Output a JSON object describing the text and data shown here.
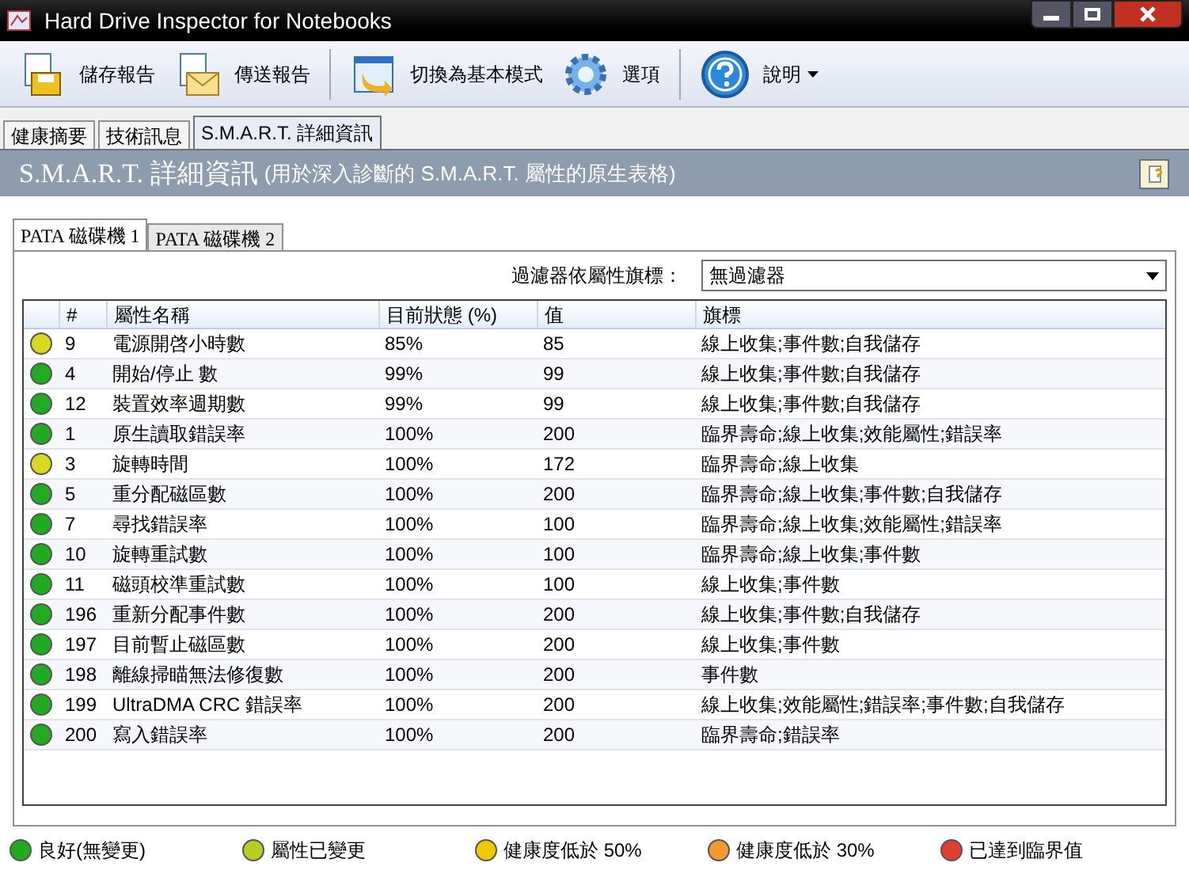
{
  "window": {
    "title": "Hard Drive Inspector for Notebooks"
  },
  "toolbar": [
    {
      "label": "儲存報告",
      "kind": "save"
    },
    {
      "label": "傳送報告",
      "kind": "send"
    },
    {
      "label": "切換為基本模式",
      "kind": "switch"
    },
    {
      "label": "選項",
      "kind": "options"
    },
    {
      "label": "說明",
      "kind": "help"
    }
  ],
  "tabs": [
    {
      "label": "健康摘要",
      "selected": false
    },
    {
      "label": "技術訊息",
      "selected": false
    },
    {
      "label": "S.M.A.R.T. 詳細資訊",
      "selected": true
    }
  ],
  "header": {
    "title": "S.M.A.R.T. 詳細資訊",
    "subtitle": "(用於深入診斷的 S.M.A.R.T. 屬性的原生表格)"
  },
  "drive_tabs": [
    {
      "label": "PATA 磁碟機 1",
      "selected": true
    },
    {
      "label": "PATA 磁碟機 2",
      "selected": false
    }
  ],
  "filter": {
    "label": "過濾器依屬性旗標：",
    "value": "無過濾器"
  },
  "table": {
    "columns": [
      "#",
      "屬性名稱",
      "目前狀態 (%)",
      "值",
      "旗標"
    ],
    "rows": [
      {
        "color": "#d8d820",
        "cells": [
          "9",
          "電源開啓小時數",
          "85%",
          "85",
          "線上收集;事件數;自我儲存"
        ]
      },
      {
        "color": "#22aa22",
        "cells": [
          "4",
          "開始/停止 數",
          "99%",
          "99",
          "線上收集;事件數;自我儲存"
        ]
      },
      {
        "color": "#22aa22",
        "cells": [
          "12",
          "裝置效率週期數",
          "99%",
          "99",
          "線上收集;事件數;自我儲存"
        ]
      },
      {
        "color": "#22aa22",
        "cells": [
          "1",
          "原生讀取錯誤率",
          "100%",
          "200",
          "臨界壽命;線上收集;效能屬性;錯誤率"
        ]
      },
      {
        "color": "#d8d820",
        "cells": [
          "3",
          "旋轉時間",
          "100%",
          "172",
          "臨界壽命;線上收集"
        ]
      },
      {
        "color": "#22aa22",
        "cells": [
          "5",
          "重分配磁區數",
          "100%",
          "200",
          "臨界壽命;線上收集;事件數;自我儲存"
        ]
      },
      {
        "color": "#22aa22",
        "cells": [
          "7",
          "尋找錯誤率",
          "100%",
          "100",
          "臨界壽命;線上收集;效能屬性;錯誤率"
        ]
      },
      {
        "color": "#22aa22",
        "cells": [
          "10",
          "旋轉重試數",
          "100%",
          "100",
          "臨界壽命;線上收集;事件數"
        ]
      },
      {
        "color": "#22aa22",
        "cells": [
          "11",
          "磁頭校準重試數",
          "100%",
          "100",
          "線上收集;事件數"
        ]
      },
      {
        "color": "#22aa22",
        "cells": [
          "196",
          "重新分配事件數",
          "100%",
          "200",
          "線上收集;事件數;自我儲存"
        ]
      },
      {
        "color": "#22aa22",
        "cells": [
          "197",
          "目前暫止磁區數",
          "100%",
          "200",
          "線上收集;事件數"
        ]
      },
      {
        "color": "#22aa22",
        "cells": [
          "198",
          "離線掃瞄無法修復數",
          "100%",
          "200",
          "事件數"
        ]
      },
      {
        "color": "#22aa22",
        "cells": [
          "199",
          "UltraDMA CRC 錯誤率",
          "100%",
          "200",
          "線上收集;效能屬性;錯誤率;事件數;自我儲存"
        ]
      },
      {
        "color": "#22aa22",
        "cells": [
          "200",
          "寫入錯誤率",
          "100%",
          "200",
          "臨界壽命;錯誤率"
        ]
      }
    ]
  },
  "legend": [
    {
      "label": "良好(無變更)",
      "color": "#22aa22"
    },
    {
      "label": "屬性已變更",
      "color": "#b8cc22"
    },
    {
      "label": "健康度低於 50%",
      "color": "#f0c800"
    },
    {
      "label": "健康度低於 30%",
      "color": "#f09a30"
    },
    {
      "label": "已達到臨界值",
      "color": "#e04030"
    }
  ]
}
